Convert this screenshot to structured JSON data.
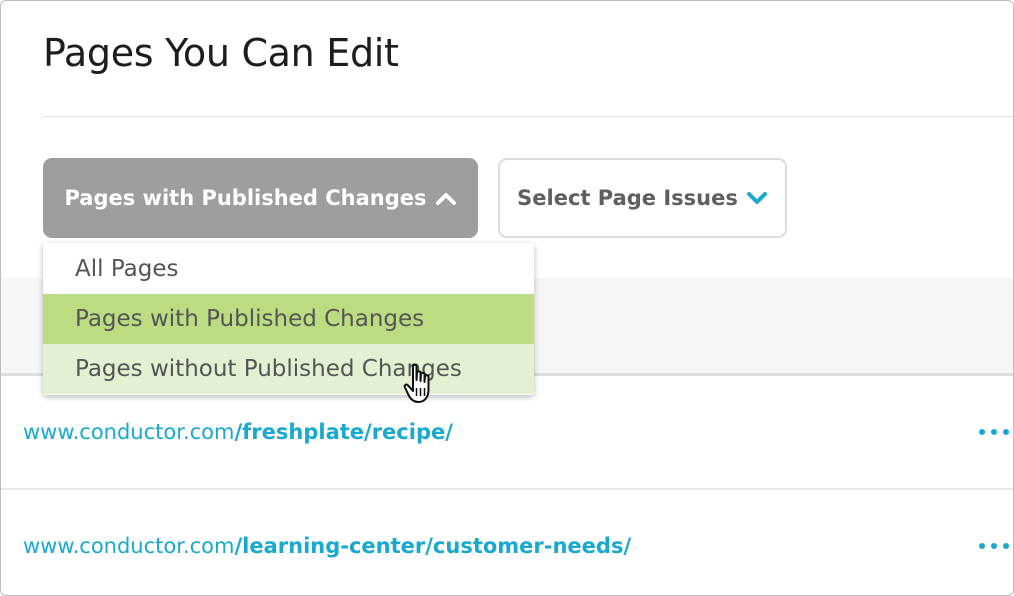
{
  "header": {
    "title": "Pages You Can Edit"
  },
  "filters": {
    "published_filter_label": "Pages with Published Changes",
    "published_filter_icon": "chevron-up-icon",
    "issues_filter_label": "Select Page Issues",
    "issues_filter_icon": "chevron-down-icon"
  },
  "dropdown": {
    "options": [
      {
        "label": "All Pages",
        "state": "default"
      },
      {
        "label": "Pages with Published Changes",
        "state": "selected"
      },
      {
        "label": "Pages without Published Changes",
        "state": "hovered"
      }
    ]
  },
  "pages": [
    {
      "domain": "www.conductor.com",
      "path": "/freshplate/recipe/",
      "menu_icon": "more-dots-icon"
    },
    {
      "domain": "www.conductor.com",
      "path": "/learning-center/customer-needs/",
      "menu_icon": "more-dots-icon"
    }
  ],
  "colors": {
    "link": "#19a9cf",
    "active_filter_bg": "#9e9e9e",
    "selected_option_bg": "#bbdc80",
    "hovered_option_bg": "#e4f0d1",
    "chevron_accent": "#19a9cf"
  }
}
